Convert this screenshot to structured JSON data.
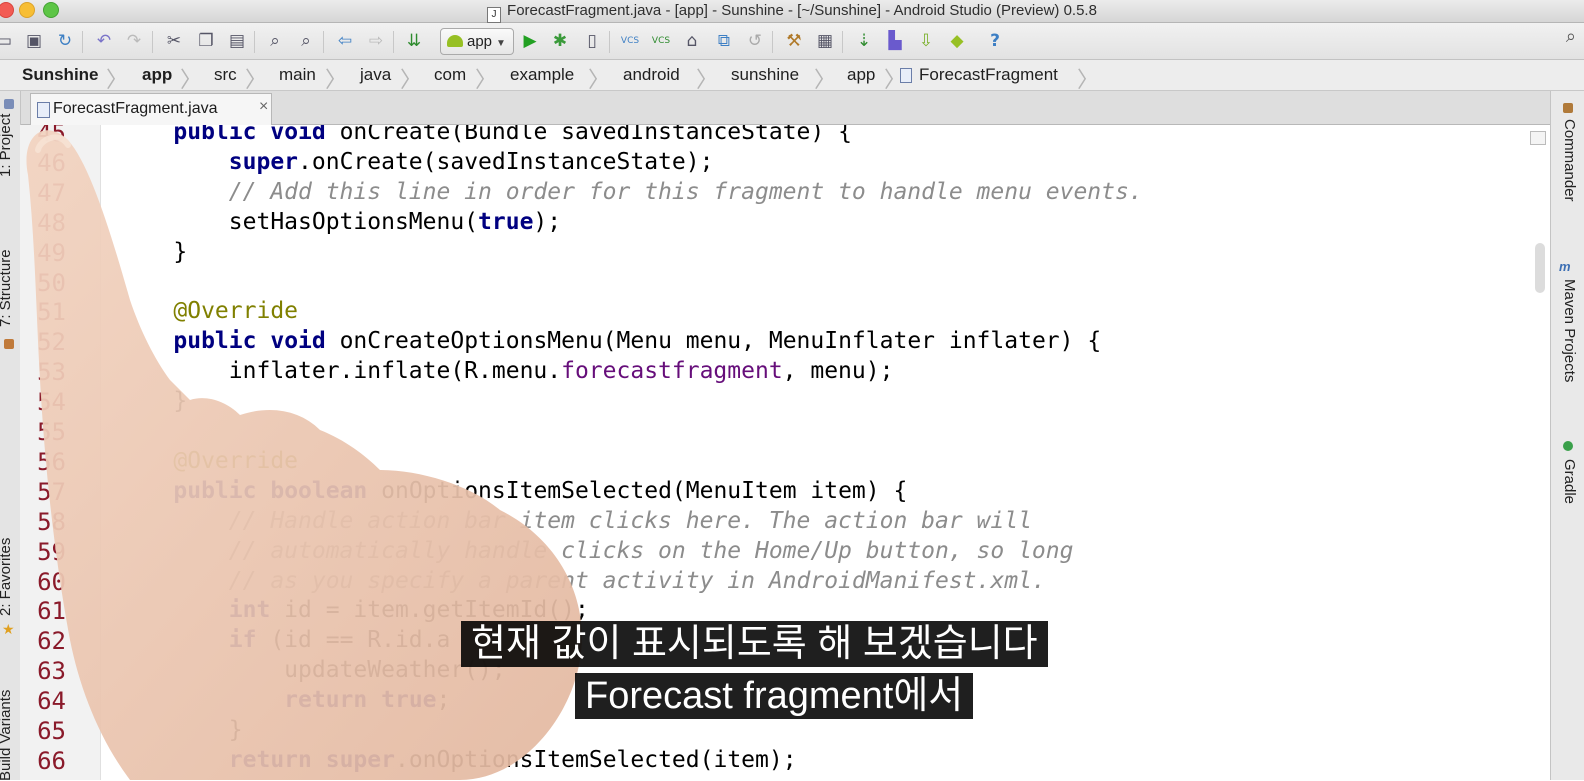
{
  "window": {
    "title": "ForecastFragment.java - [app] - Sunshine - [~/Sunshine] - Android Studio (Preview) 0.5.8"
  },
  "toolbar": {
    "run_config": "app",
    "vcs_label": "VCS"
  },
  "breadcrumb": [
    "Sunshine",
    "app",
    "src",
    "main",
    "java",
    "com",
    "example",
    "android",
    "sunshine",
    "app",
    "ForecastFragment"
  ],
  "tabs": [
    {
      "label": "ForecastFragment.java",
      "close": "×"
    }
  ],
  "left_tool_windows": [
    "1: Project",
    "7: Structure",
    "2: Favorites",
    "Build Variants"
  ],
  "right_tool_windows": [
    "Commander",
    "Maven Projects",
    "Gradle"
  ],
  "editor": {
    "lines": [
      {
        "n": "45",
        "tokens": [
          {
            "t": "    "
          },
          {
            "t": "public",
            "c": "kw"
          },
          {
            "t": " "
          },
          {
            "t": "void",
            "c": "kw"
          },
          {
            "t": " onCreate(Bundle savedInstanceState) {"
          }
        ]
      },
      {
        "n": "46",
        "tokens": [
          {
            "t": "        "
          },
          {
            "t": "super",
            "c": "kw"
          },
          {
            "t": ".onCreate(savedInstanceState);"
          }
        ]
      },
      {
        "n": "47",
        "tokens": [
          {
            "t": "        "
          },
          {
            "t": "// Add this line in order for this fragment to handle menu events.",
            "c": "cm"
          }
        ]
      },
      {
        "n": "48",
        "tokens": [
          {
            "t": "        setHasOptionsMenu("
          },
          {
            "t": "true",
            "c": "kw"
          },
          {
            "t": ");"
          }
        ]
      },
      {
        "n": "49",
        "tokens": [
          {
            "t": "    }"
          }
        ]
      },
      {
        "n": "50",
        "tokens": [
          {
            "t": ""
          }
        ]
      },
      {
        "n": "51",
        "tokens": [
          {
            "t": "    "
          },
          {
            "t": "@Override",
            "c": "an"
          }
        ]
      },
      {
        "n": "52",
        "tokens": [
          {
            "t": "    "
          },
          {
            "t": "public",
            "c": "kw"
          },
          {
            "t": " "
          },
          {
            "t": "void",
            "c": "kw"
          },
          {
            "t": " onCreateOptionsMenu(Menu menu, MenuInflater inflater) {"
          }
        ]
      },
      {
        "n": "53",
        "tokens": [
          {
            "t": "        inflater.inflate(R.menu."
          },
          {
            "t": "forecastfragment",
            "c": "ref"
          },
          {
            "t": ", menu);"
          }
        ]
      },
      {
        "n": "54",
        "tokens": [
          {
            "t": "    }"
          }
        ]
      },
      {
        "n": "55",
        "tokens": [
          {
            "t": ""
          }
        ]
      },
      {
        "n": "56",
        "tokens": [
          {
            "t": "    "
          },
          {
            "t": "@Override",
            "c": "an"
          }
        ]
      },
      {
        "n": "57",
        "tokens": [
          {
            "t": "    "
          },
          {
            "t": "public",
            "c": "kw"
          },
          {
            "t": " "
          },
          {
            "t": "boolean",
            "c": "kw"
          },
          {
            "t": " onOptionsItemSelected(MenuItem item) {"
          }
        ]
      },
      {
        "n": "58",
        "tokens": [
          {
            "t": "        "
          },
          {
            "t": "// Handle action bar item clicks here. The action bar will",
            "c": "cm"
          }
        ]
      },
      {
        "n": "59",
        "tokens": [
          {
            "t": "        "
          },
          {
            "t": "// automatically handle clicks on the Home/Up button, so long",
            "c": "cm"
          }
        ]
      },
      {
        "n": "60",
        "tokens": [
          {
            "t": "        "
          },
          {
            "t": "// as you specify a parent activity in AndroidManifest.xml.",
            "c": "cm"
          }
        ]
      },
      {
        "n": "61",
        "tokens": [
          {
            "t": "        "
          },
          {
            "t": "int",
            "c": "kw"
          },
          {
            "t": " id = item.getItemId();"
          }
        ]
      },
      {
        "n": "62",
        "tokens": [
          {
            "t": "        "
          },
          {
            "t": "if",
            "c": "kw"
          },
          {
            "t": " (id == R.id.a"
          }
        ]
      },
      {
        "n": "63",
        "tokens": [
          {
            "t": "            updateWeather();"
          }
        ]
      },
      {
        "n": "64",
        "tokens": [
          {
            "t": "            "
          },
          {
            "t": "return",
            "c": "kw"
          },
          {
            "t": " "
          },
          {
            "t": "true",
            "c": "kw"
          },
          {
            "t": ";"
          }
        ]
      },
      {
        "n": "65",
        "tokens": [
          {
            "t": "        }"
          }
        ]
      },
      {
        "n": "66",
        "tokens": [
          {
            "t": "        "
          },
          {
            "t": "return",
            "c": "kw"
          },
          {
            "t": " "
          },
          {
            "t": "super",
            "c": "kw"
          },
          {
            "t": ".onOptionsItemSelected(item);"
          }
        ]
      }
    ]
  },
  "subtitles": {
    "line1": "현재 값이 표시되도록 해 보겠습니다",
    "line2": "Forecast fragment에서"
  },
  "colors": {
    "keyword": "#000080",
    "comment": "#8c8c8c",
    "annotation": "#808000",
    "line_number": "#8a1a2a"
  }
}
